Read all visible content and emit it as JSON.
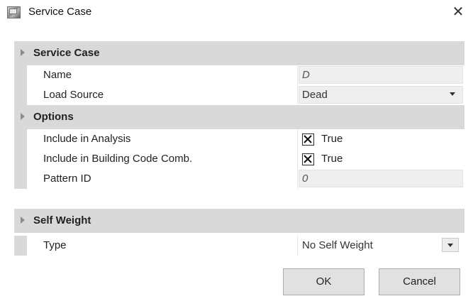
{
  "window": {
    "title": "Service Case",
    "close_glyph": "✕"
  },
  "sections": {
    "service_case": {
      "label": "Service Case",
      "name": {
        "label": "Name",
        "value": "D"
      },
      "load_source": {
        "label": "Load Source",
        "value": "Dead"
      }
    },
    "options": {
      "label": "Options",
      "include_analysis": {
        "label": "Include in Analysis",
        "checked": true,
        "value": "True"
      },
      "include_code_comb": {
        "label": "Include in Building Code Comb.",
        "checked": true,
        "value": "True"
      },
      "pattern_id": {
        "label": "Pattern ID",
        "value": "0"
      }
    },
    "self_weight": {
      "label": "Self Weight",
      "type": {
        "label": "Type",
        "value": "No Self Weight"
      }
    }
  },
  "buttons": {
    "ok": "OK",
    "cancel": "Cancel"
  },
  "icons": [
    "app-icon",
    "close-icon",
    "expand-triangle-icon",
    "dropdown-arrow-icon",
    "checkbox-x-icon"
  ]
}
